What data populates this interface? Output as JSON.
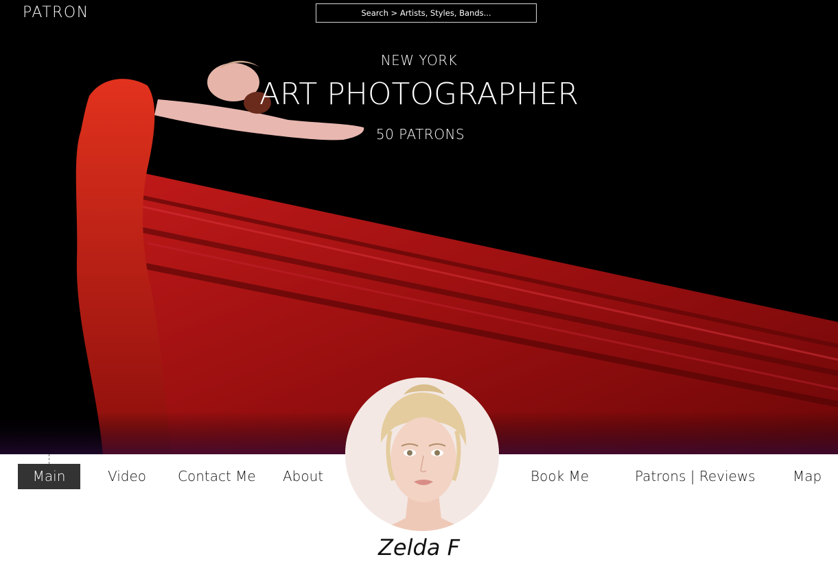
{
  "header": {
    "logo": "PATRON",
    "search_placeholder": "Search > Artists, Styles, Bands..."
  },
  "hero": {
    "location": "NEW YORK",
    "profession": "ART PHOTOGRAPHER",
    "patrons": "50 PATRONS"
  },
  "nav": {
    "items": [
      {
        "label": "Main",
        "active": true
      },
      {
        "label": "Video"
      },
      {
        "label": "Contact Me"
      },
      {
        "label": "About"
      },
      {
        "label": "Book Me"
      },
      {
        "label": "Patrons | Reviews"
      },
      {
        "label": "Map"
      }
    ]
  },
  "profile": {
    "name": "Zelda F"
  },
  "colors": {
    "hero_background": "#000000",
    "fabric_red": "#b01818",
    "nav_active_bg": "#333333",
    "nav_text": "#111111"
  }
}
